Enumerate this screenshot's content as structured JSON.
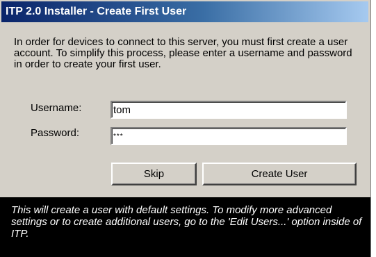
{
  "window": {
    "title": "ITP 2.0 Installer - Create First User"
  },
  "intro": {
    "text": "In order for devices to connect to this server, you must first create a user account.  To simplify this process, please enter a username and password in order to create your first user."
  },
  "form": {
    "username_label": "Username:",
    "username_value": "tom",
    "password_label": "Password:",
    "password_value": "***"
  },
  "buttons": {
    "skip_label": "Skip",
    "create_label": "Create User"
  },
  "footer": {
    "text": "This will create a user with default settings.  To modify more advanced settings or to create additional users, go to the 'Edit Users...' option inside of ITP."
  },
  "colors": {
    "dialog_background": "#d4d0c8",
    "titlebar_start": "#0a246a",
    "titlebar_end": "#a6caf0",
    "footer_background": "#000000",
    "footer_text": "#ffffff"
  }
}
